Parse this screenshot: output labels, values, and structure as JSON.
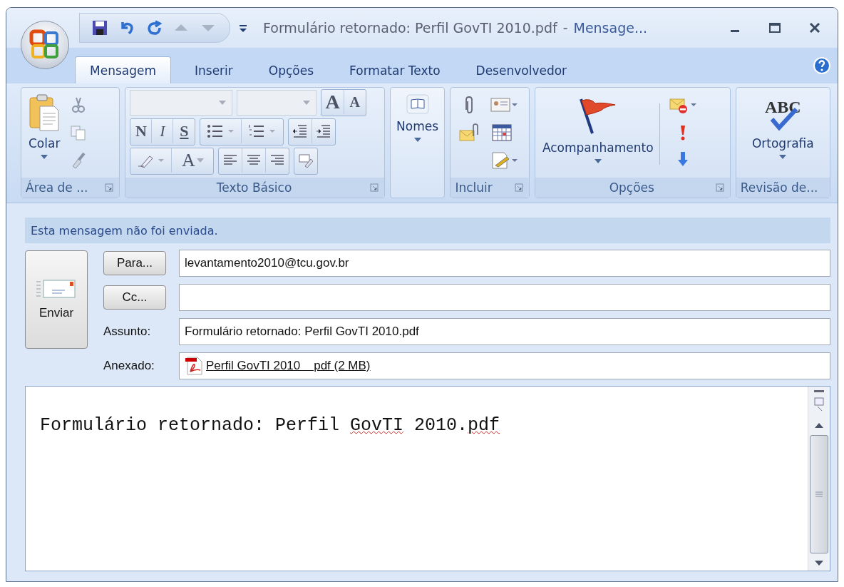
{
  "window": {
    "title": "Formulário retornado: Perfil GovTI 2010.pdf",
    "separator": "-",
    "app": "Mensage..."
  },
  "tabs": [
    {
      "label": "Mensagem",
      "selected": true
    },
    {
      "label": "Inserir",
      "selected": false
    },
    {
      "label": "Opções",
      "selected": false
    },
    {
      "label": "Formatar Texto",
      "selected": false
    },
    {
      "label": "Desenvolvedor",
      "selected": false
    }
  ],
  "ribbon": {
    "clipboard": {
      "label": "Área de ...",
      "paste": "Colar"
    },
    "basic_text": {
      "label": "Texto Básico",
      "grow": "A",
      "shrink": "A",
      "bold": "N",
      "italic": "I",
      "underline": "S",
      "font_color": "A"
    },
    "names": {
      "label": "Nomes"
    },
    "include": {
      "label": "Incluir"
    },
    "options": {
      "label": "Opções",
      "follow_up": "Acompanhamento"
    },
    "proofing": {
      "label": "Revisão de...",
      "spelling": "Ortografia",
      "icon_text": "ABC"
    }
  },
  "info_bar": "Esta mensagem não foi enviada.",
  "send": "Enviar",
  "to": {
    "button": "Para...",
    "value": "levantamento2010@tcu.gov.br"
  },
  "cc": {
    "button": "Cc..."
  },
  "subject": {
    "label": "Assunto:",
    "value": "Formulário retornado: Perfil GovTI 2010.pdf"
  },
  "attachments": {
    "label": "Anexado:",
    "items": [
      {
        "name": "Perfil GovTI 2010    pdf (2 MB)"
      }
    ]
  },
  "body": [
    {
      "text": "Formulário retornado: Perfil ",
      "misspelled": false
    },
    {
      "text": "GovTI",
      "misspelled": true
    },
    {
      "text": " 2010.",
      "misspelled": false
    },
    {
      "text": "pdf",
      "misspelled": true
    }
  ]
}
